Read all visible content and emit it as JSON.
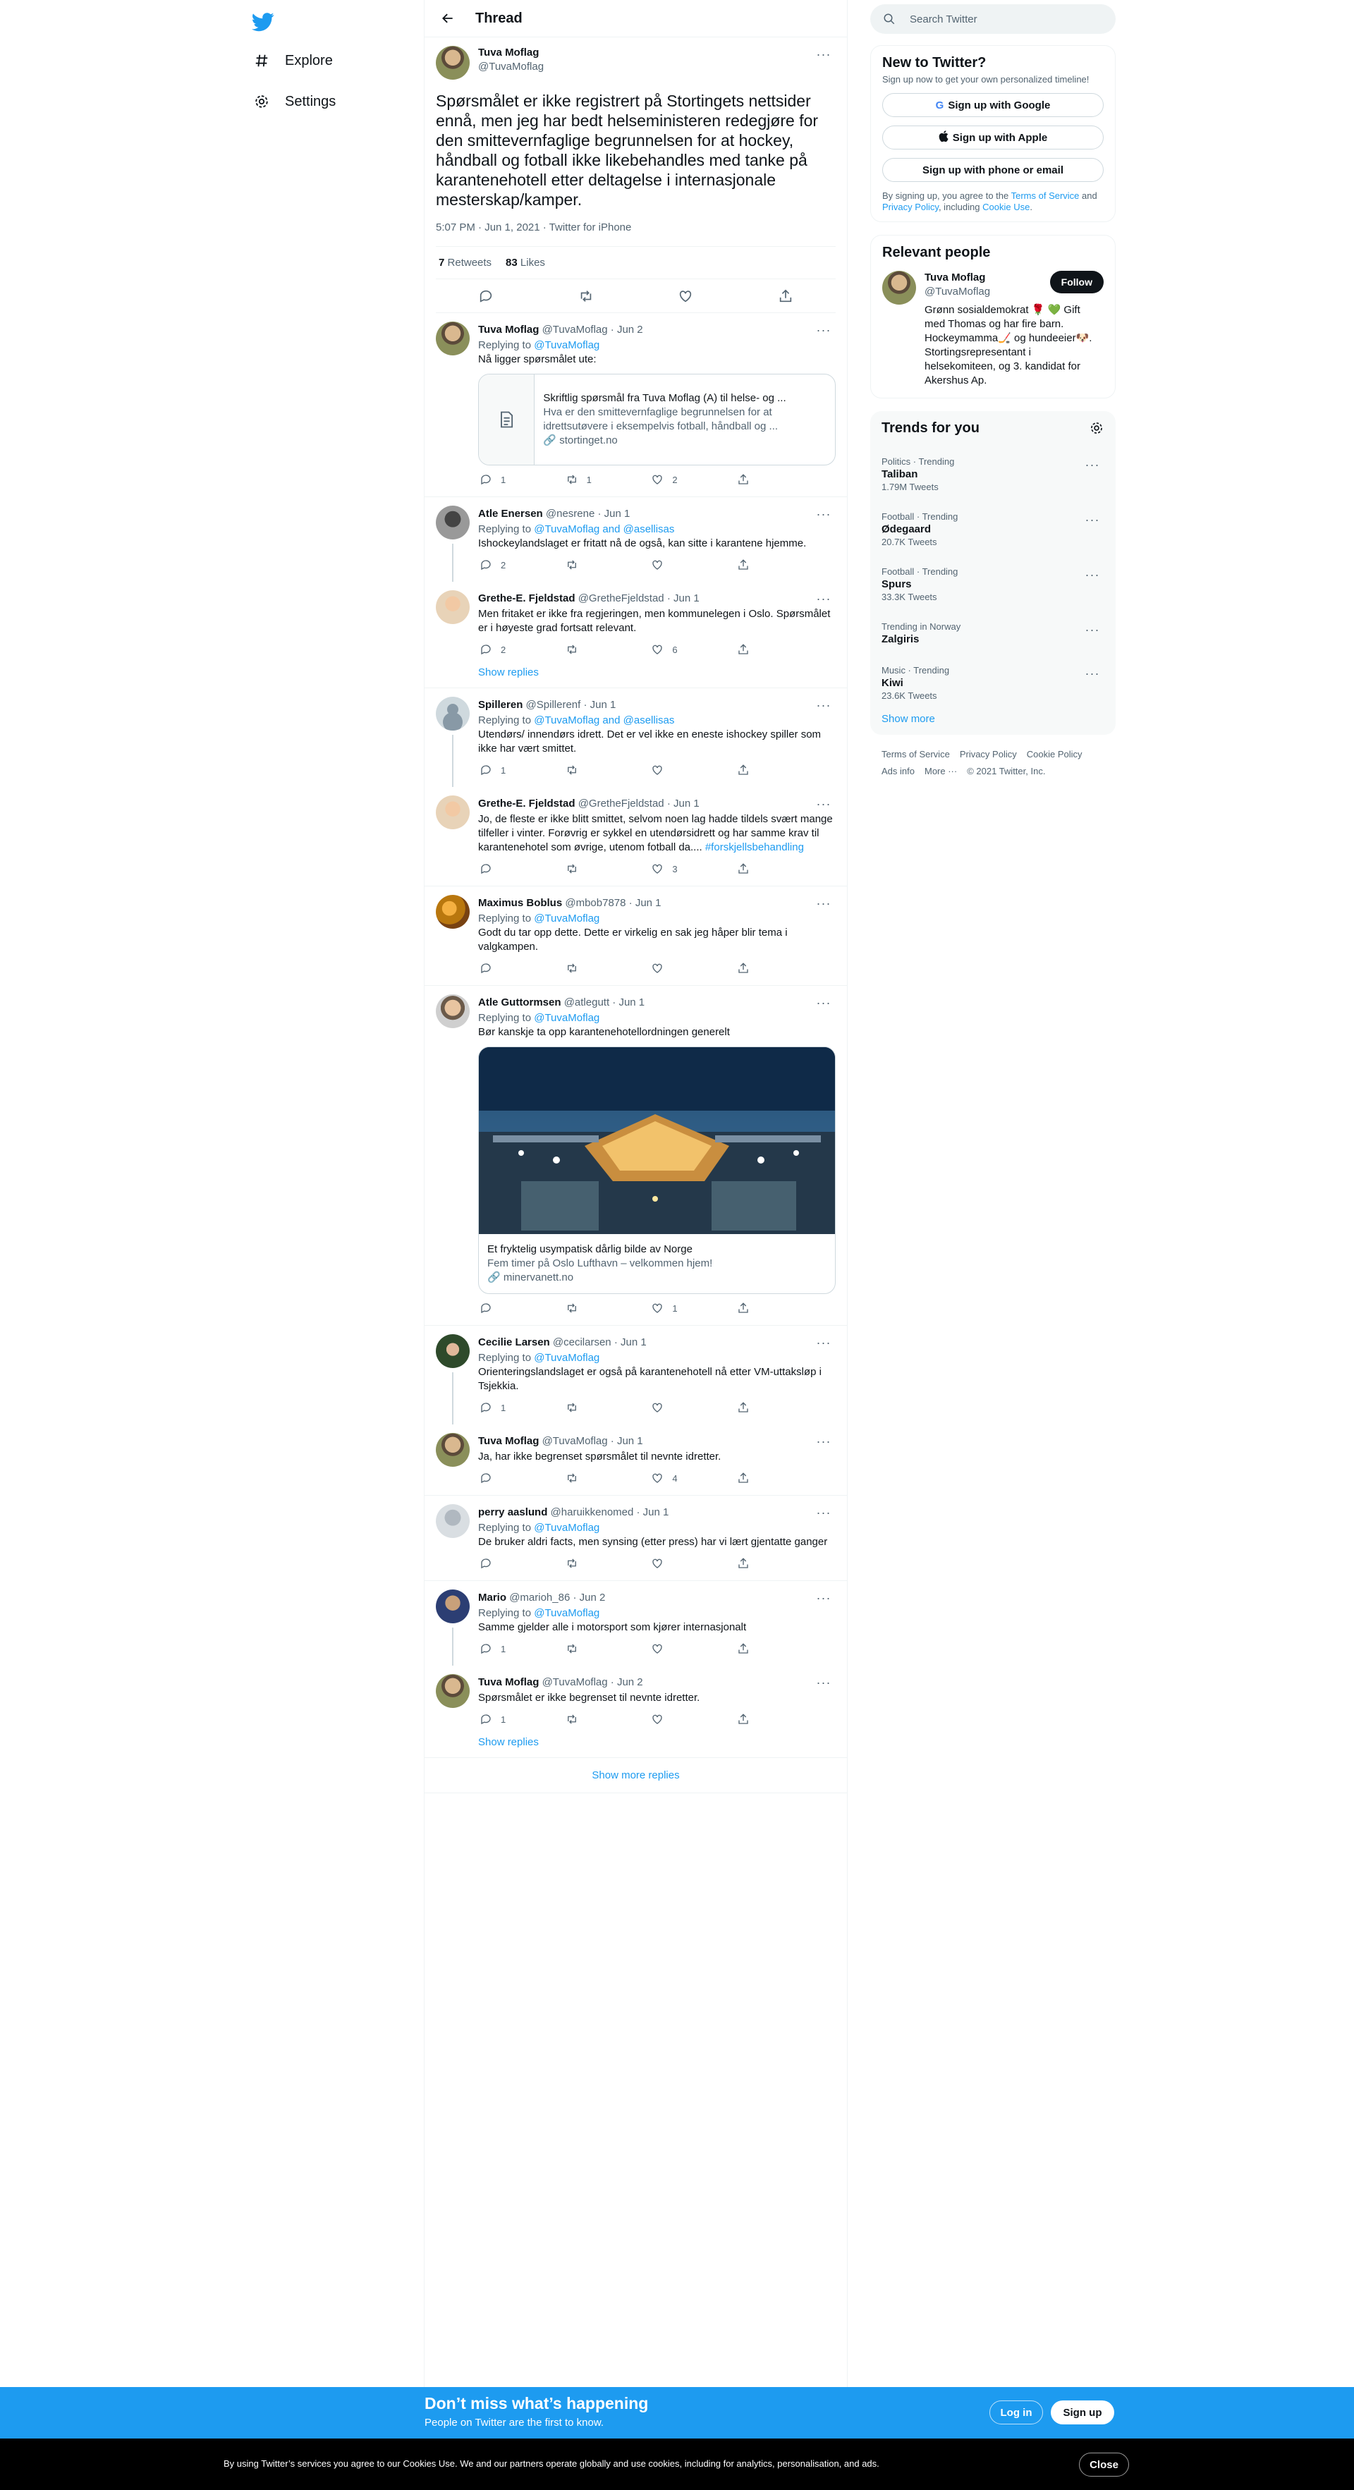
{
  "nav": {
    "explore": "Explore",
    "settings": "Settings"
  },
  "header": {
    "title": "Thread"
  },
  "main_tweet": {
    "name": "Tuva Moflag",
    "handle": "@TuvaMoflag",
    "text": "Spørsmålet er ikke registrert på Stortingets nettsider ennå, men jeg har bedt helseministeren redegjøre for den smittevernfaglige begrunnelsen for at hockey, håndball og fotball ikke likebehandles med tanke på karantenehotell etter deltagelse i internasjonale mesterskap/kamper.",
    "meta": "5:07 PM · Jun 1, 2021 · Twitter for iPhone",
    "retweets_count": "7",
    "retweets_label": "Retweets",
    "likes_count": "83",
    "likes_label": "Likes"
  },
  "replies": [
    {
      "name": "Tuva Moflag",
      "handle": "@TuvaMoflag",
      "date": "· Jun 2",
      "replying": "Replying to ",
      "replying_to": "@TuvaMoflag",
      "text": "Nå ligger spørsmålet ute:",
      "card": {
        "title": "Skriftlig spørsmål fra Tuva Moflag (A) til helse- og ...",
        "desc": "Hva er den smittevernfaglige begrunnelsen for at idrettsutøvere i eksempelvis fotball, håndball og ...",
        "domain": "stortinget.no"
      },
      "replies": "1",
      "retweets": "1",
      "likes": "2"
    },
    {
      "name": "Atle Enersen",
      "handle": "@nesrene",
      "date": "· Jun 1",
      "replying": "Replying to ",
      "replying_to": "@TuvaMoflag and @asellisas",
      "text": "Ishockeylandslaget er fritatt nå de også, kan sitte i karantene hjemme.",
      "replies": "2",
      "retweets": "",
      "likes": ""
    },
    {
      "name": "Grethe-E. Fjeldstad",
      "handle": "@GretheFjeldstad",
      "date": "· Jun 1",
      "text": "Men fritaket er ikke fra regjeringen, men kommunelegen i Oslo. Spørsmålet er i høyeste grad fortsatt relevant.",
      "replies": "2",
      "retweets": "",
      "likes": "6"
    },
    {
      "name": "Spilleren",
      "handle": "@Spillerenf",
      "date": "· Jun 1",
      "replying": "Replying to ",
      "replying_to": "@TuvaMoflag and @asellisas",
      "text": "Utendørs/ innendørs idrett. Det er vel ikke en eneste ishockey spiller som ikke har vært smittet.",
      "replies": "1",
      "retweets": "",
      "likes": ""
    },
    {
      "name": "Grethe-E. Fjeldstad",
      "handle": "@GretheFjeldstad",
      "date": "· Jun 1",
      "text": "Jo, de fleste er ikke blitt smittet, selvom noen lag hadde tildels svært mange tilfeller i vinter. Forøvrig er sykkel en utendørsidrett og har samme krav til karantenehotel som øvrige, utenom fotball da.... ",
      "hashtag": "#forskjellsbehandling",
      "replies": "",
      "retweets": "",
      "likes": "3"
    },
    {
      "name": "Maximus Boblus",
      "handle": "@mbob7878",
      "date": "· Jun 1",
      "replying": "Replying to ",
      "replying_to": "@TuvaMoflag",
      "text": "Godt du tar opp dette. Dette er virkelig en sak jeg håper blir tema i valgkampen.",
      "replies": "",
      "retweets": "",
      "likes": ""
    },
    {
      "name": "Atle Guttormsen",
      "handle": "@atlegutt",
      "date": "· Jun 1",
      "replying": "Replying to ",
      "replying_to": "@TuvaMoflag",
      "text": "Bør kanskje ta opp karantenehotellordningen generelt",
      "card": {
        "title": "Et fryktelig usympatisk dårlig bilde av Norge",
        "desc": "Fem timer på Oslo Lufthavn – velkommen hjem!",
        "domain": "minervanett.no"
      },
      "replies": "",
      "retweets": "",
      "likes": "1"
    },
    {
      "name": "Cecilie Larsen",
      "handle": "@cecilarsen",
      "date": "· Jun 1",
      "replying": "Replying to ",
      "replying_to": "@TuvaMoflag",
      "text": "Orienteringslandslaget er også på karantenehotell nå etter VM-uttaksløp i Tsjekkia.",
      "replies": "1",
      "retweets": "",
      "likes": ""
    },
    {
      "name": "Tuva Moflag",
      "handle": "@TuvaMoflag",
      "date": "· Jun 1",
      "text": "Ja, har ikke begrenset spørsmålet til nevnte idretter.",
      "replies": "",
      "retweets": "",
      "likes": "4"
    },
    {
      "name": "perry aaslund",
      "handle": "@haruikkenomed",
      "date": "· Jun 1",
      "replying": "Replying to ",
      "replying_to": "@TuvaMoflag",
      "text": "De bruker aldri facts, men synsing (etter press) har vi lært gjentatte ganger",
      "replies": "",
      "retweets": "",
      "likes": ""
    },
    {
      "name": "Mario",
      "handle": "@marioh_86",
      "date": "· Jun 2",
      "replying": "Replying to ",
      "replying_to": "@TuvaMoflag",
      "text": "Samme gjelder alle i motorsport som kjører internasjonalt",
      "replies": "1",
      "retweets": "",
      "likes": ""
    },
    {
      "name": "Tuva Moflag",
      "handle": "@TuvaMoflag",
      "date": "· Jun 2",
      "text": "Spørsmålet er ikke begrenset til nevnte idretter.",
      "replies": "1",
      "retweets": "",
      "likes": ""
    }
  ],
  "show_replies": "Show replies",
  "show_more_replies": "Show more replies",
  "search": {
    "placeholder": "Search Twitter"
  },
  "new_to_twitter": {
    "title": "New to Twitter?",
    "subtitle": "Sign up now to get your own personalized timeline!",
    "google": "Sign up with Google",
    "apple": "Sign up with Apple",
    "phone": "Sign up with phone or email",
    "legal_pre": "By signing up, you agree to the ",
    "terms": "Terms of Service",
    "and": " and ",
    "privacy": "Privacy Policy",
    "including": ", including ",
    "cookie": "Cookie Use",
    "dot": "."
  },
  "relevant": {
    "title": "Relevant people",
    "name": "Tuva Moflag",
    "handle": "@TuvaMoflag",
    "follow": "Follow",
    "bio": "Grønn sosialdemokrat 🌹 💚 Gift med Thomas og har fire barn. Hockeymamma🏒 og hundeeier🐶. Stortingsrepresentant i helsekomiteen, og 3. kandidat for Akershus Ap."
  },
  "trends": {
    "title": "Trends for you",
    "items": [
      {
        "cat": "Politics · Trending",
        "name": "Taliban",
        "count": "1.79M Tweets"
      },
      {
        "cat": "Football · Trending",
        "name": "Ødegaard",
        "count": "20.7K Tweets"
      },
      {
        "cat": "Football · Trending",
        "name": "Spurs",
        "count": "33.3K Tweets"
      },
      {
        "cat": "Trending in Norway",
        "name": "Zalgiris",
        "count": ""
      },
      {
        "cat": "Music · Trending",
        "name": "Kiwi",
        "count": "23.6K Tweets"
      }
    ],
    "show_more": "Show more"
  },
  "footer": {
    "terms": "Terms of Service",
    "privacy": "Privacy Policy",
    "cookie": "Cookie Policy",
    "ads": "Ads info",
    "more": "More ···",
    "copy": "© 2021 Twitter, Inc."
  },
  "bottom": {
    "title": "Don’t miss what’s happening",
    "subtitle": "People on Twitter are the first to know.",
    "login": "Log in",
    "signup": "Sign up"
  },
  "cookie": {
    "text": "By using Twitter’s services you agree to our Cookies Use. We and our partners operate globally and use cookies, including for analytics, personalisation, and ads.",
    "close": "Close"
  },
  "colors": {
    "accent": "#1d9bf0",
    "text": "#0f1419",
    "muted": "#536471"
  }
}
